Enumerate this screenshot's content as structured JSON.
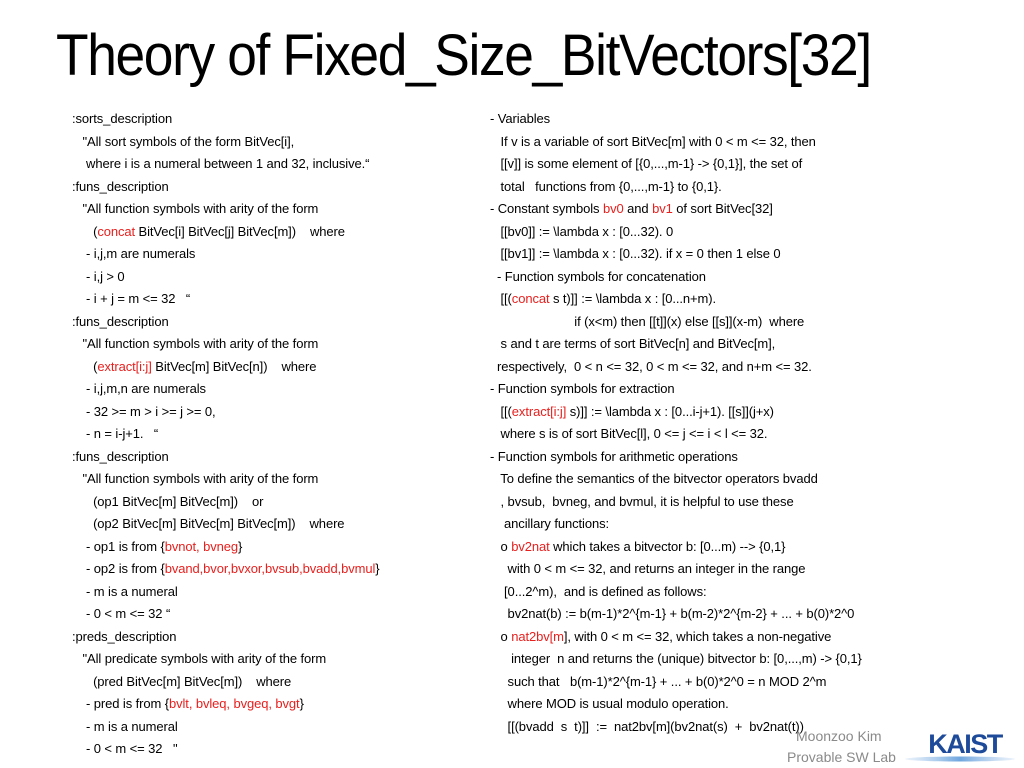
{
  "slide": {
    "title": "Theory of Fixed_Size_BitVectors[32]",
    "left_column": [
      [
        {
          "t": ":sorts_description"
        }
      ],
      [
        {
          "t": "   \"All sort symbols of the form BitVec[i],"
        }
      ],
      [
        {
          "t": "    where i is a numeral between 1 and 32, inclusive.“"
        }
      ],
      [
        {
          "t": ":funs_description"
        }
      ],
      [
        {
          "t": "   \"All function symbols with arity of the form"
        }
      ],
      [
        {
          "t": "      ("
        },
        {
          "t": "concat",
          "red": true
        },
        {
          "t": " BitVec[i] BitVec[j] BitVec[m])    where"
        }
      ],
      [
        {
          "t": "    - i,j,m are numerals"
        }
      ],
      [
        {
          "t": "    - i,j > 0"
        }
      ],
      [
        {
          "t": "    - i + j = m <= 32   “"
        }
      ],
      [
        {
          "t": ":funs_description"
        }
      ],
      [
        {
          "t": "   \"All function symbols with arity of the form"
        }
      ],
      [
        {
          "t": "      ("
        },
        {
          "t": "extract[i:j]",
          "red": true
        },
        {
          "t": " BitVec[m] BitVec[n])    where"
        }
      ],
      [
        {
          "t": "    - i,j,m,n are numerals"
        }
      ],
      [
        {
          "t": "    - 32 >= m > i >= j >= 0,"
        }
      ],
      [
        {
          "t": "    - n = i-j+1.   “"
        }
      ],
      [
        {
          "t": ":funs_description"
        }
      ],
      [
        {
          "t": "   \"All function symbols with arity of the form"
        }
      ],
      [
        {
          "t": "      (op1 BitVec[m] BitVec[m])    or"
        }
      ],
      [
        {
          "t": "      (op2 BitVec[m] BitVec[m] BitVec[m])    where"
        }
      ],
      [
        {
          "t": "    - op1 is from {"
        },
        {
          "t": "bvnot, bvneg",
          "red": true
        },
        {
          "t": "}"
        }
      ],
      [
        {
          "t": "    - op2 is from {"
        },
        {
          "t": "bvand,bvor,bvxor,bvsub,bvadd,bvmul",
          "red": true
        },
        {
          "t": "}"
        }
      ],
      [
        {
          "t": "    - m is a numeral"
        }
      ],
      [
        {
          "t": "    - 0 < m <= 32 “"
        }
      ],
      [
        {
          "t": ":preds_description"
        }
      ],
      [
        {
          "t": "   \"All predicate symbols with arity of the form"
        }
      ],
      [
        {
          "t": "      (pred BitVec[m] BitVec[m])    where"
        }
      ],
      [
        {
          "t": "    - pred is from {"
        },
        {
          "t": "bvlt, bvleq, bvgeq, bvgt",
          "red": true
        },
        {
          "t": "}"
        }
      ],
      [
        {
          "t": "    - m is a numeral"
        }
      ],
      [
        {
          "t": "    - 0 < m <= 32   \""
        }
      ]
    ],
    "right_column": [
      [
        {
          "t": "- Variables"
        }
      ],
      [
        {
          "t": "   If v is a variable of sort BitVec[m] with 0 < m <= 32, then"
        }
      ],
      [
        {
          "t": "   [[v]] is some element of [{0,...,m-1} -> {0,1}], the set of"
        }
      ],
      [
        {
          "t": "   total   functions from {0,...,m-1} to {0,1}."
        }
      ],
      [
        {
          "t": "- Constant symbols "
        },
        {
          "t": "bv0",
          "red": true
        },
        {
          "t": " and "
        },
        {
          "t": "bv1",
          "red": true
        },
        {
          "t": " of sort BitVec[32]"
        }
      ],
      [
        {
          "t": "   [[bv0]] := \\lambda x : [0...32). 0"
        }
      ],
      [
        {
          "t": "   [[bv1]] := \\lambda x : [0...32). if x = 0 then 1 else 0"
        }
      ],
      [
        {
          "t": "  - Function symbols for concatenation"
        }
      ],
      [
        {
          "t": "   [[("
        },
        {
          "t": "concat",
          "red": true
        },
        {
          "t": " s t)]] := \\lambda x : [0...n+m)."
        }
      ],
      [
        {
          "t": "                        if (x<m) then [[t]](x) else [[s]](x-m)  where"
        }
      ],
      [
        {
          "t": "   s and t are terms of sort BitVec[n] and BitVec[m],"
        }
      ],
      [
        {
          "t": "  respectively,  0 < n <= 32, 0 < m <= 32, and n+m <= 32."
        }
      ],
      [
        {
          "t": "- Function symbols for extraction"
        }
      ],
      [
        {
          "t": "   [[("
        },
        {
          "t": "extract[i:j]",
          "red": true
        },
        {
          "t": " s)]] := \\lambda x : [0...i-j+1). [[s]](j+x)"
        }
      ],
      [
        {
          "t": "   where s is of sort BitVec[l], 0 <= j <= i < l <= 32."
        }
      ],
      [
        {
          "t": "- Function symbols for arithmetic operations"
        }
      ],
      [
        {
          "t": "   To define the semantics of the bitvector operators bvadd"
        }
      ],
      [
        {
          "t": "   , bvsub,  bvneg, and bvmul, it is helpful to use these"
        }
      ],
      [
        {
          "t": "    ancillary functions:"
        }
      ],
      [
        {
          "t": "   o "
        },
        {
          "t": "bv2nat",
          "red": true
        },
        {
          "t": " which takes a bitvector b: [0...m) --> {0,1}"
        }
      ],
      [
        {
          "t": "     with 0 < m <= 32, and returns an integer in the range"
        }
      ],
      [
        {
          "t": "    [0...2^m),  and is defined as follows:"
        }
      ],
      [
        {
          "t": "     bv2nat(b) := b(m-1)*2^{m-1} + b(m-2)*2^{m-2} + ... + b(0)*2^0"
        }
      ],
      [
        {
          "t": "   o "
        },
        {
          "t": "nat2bv[m",
          "red": true
        },
        {
          "t": "], with 0 < m <= 32, which takes a non-negative"
        }
      ],
      [
        {
          "t": "      integer  n and returns the (unique) bitvector b: [0,...,m) -> {0,1}"
        }
      ],
      [
        {
          "t": "     such that   b(m-1)*2^{m-1} + ... + b(0)*2^0 = n MOD 2^m"
        }
      ],
      [
        {
          "t": "     where MOD is usual modulo operation."
        }
      ],
      [
        {
          "t": "     [[(bvadd  s  t)]]  :=  nat2bv[m](bv2nat(s)  +  bv2nat(t))"
        }
      ]
    ],
    "footer": {
      "author": "Moonzoo Kim",
      "lab": "Provable SW Lab",
      "logo_text": "KAIST",
      "logo_color": "#1e4a9a"
    },
    "accent_color": "#e8201e"
  }
}
